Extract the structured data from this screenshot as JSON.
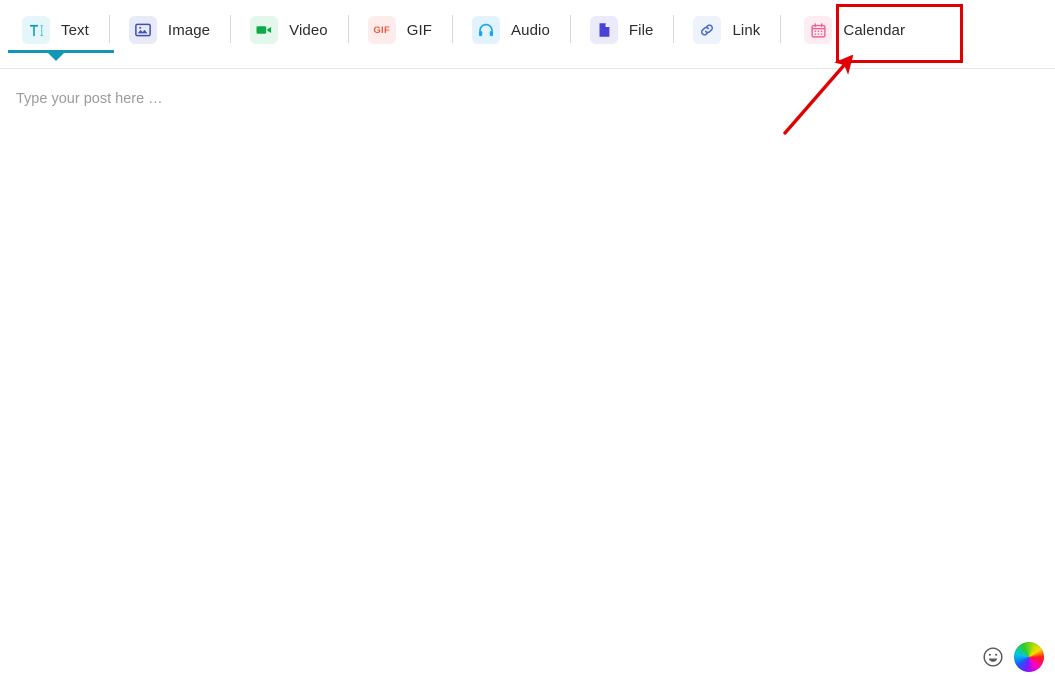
{
  "toolbar": {
    "tabs": [
      {
        "id": "text",
        "label": "Text",
        "icon": "text-format-icon",
        "icon_color": "#1397b4",
        "icon_bg": "#e4f6f9",
        "active": true
      },
      {
        "id": "image",
        "label": "Image",
        "icon": "image-icon",
        "icon_color": "#3f51b5",
        "icon_bg": "#e8eaf8",
        "active": false
      },
      {
        "id": "video",
        "label": "Video",
        "icon": "video-camera-icon",
        "icon_color": "#0fa84a",
        "icon_bg": "#e3f8ea",
        "active": false
      },
      {
        "id": "gif",
        "label": "GIF",
        "icon": "gif-icon",
        "icon_color": "#ef5a3c",
        "icon_bg": "#fdeceb",
        "active": false
      },
      {
        "id": "audio",
        "label": "Audio",
        "icon": "headphones-icon",
        "icon_color": "#19a6f0",
        "icon_bg": "#e3f3fd",
        "active": false
      },
      {
        "id": "file",
        "label": "File",
        "icon": "file-icon",
        "icon_color": "#4a42d8",
        "icon_bg": "#ebeafb",
        "active": false
      },
      {
        "id": "link",
        "label": "Link",
        "icon": "link-icon",
        "icon_color": "#4a6fd0",
        "icon_bg": "#eef2fc",
        "active": false
      },
      {
        "id": "calendar",
        "label": "Calendar",
        "icon": "calendar-icon",
        "icon_color": "#f06292",
        "icon_bg": "#fdecf1",
        "active": false
      }
    ]
  },
  "composer": {
    "placeholder": "Type your post here …",
    "value": ""
  },
  "bottom_tools": [
    {
      "id": "emoji",
      "icon": "emoji-smiley-icon"
    },
    {
      "id": "color-picker",
      "icon": "color-wheel-icon"
    }
  ],
  "annotations": {
    "highlight": {
      "target": "calendar",
      "color": "#e00000",
      "shape": "rectangle"
    },
    "arrow": {
      "color": "#e00000",
      "points_to": "calendar"
    }
  }
}
